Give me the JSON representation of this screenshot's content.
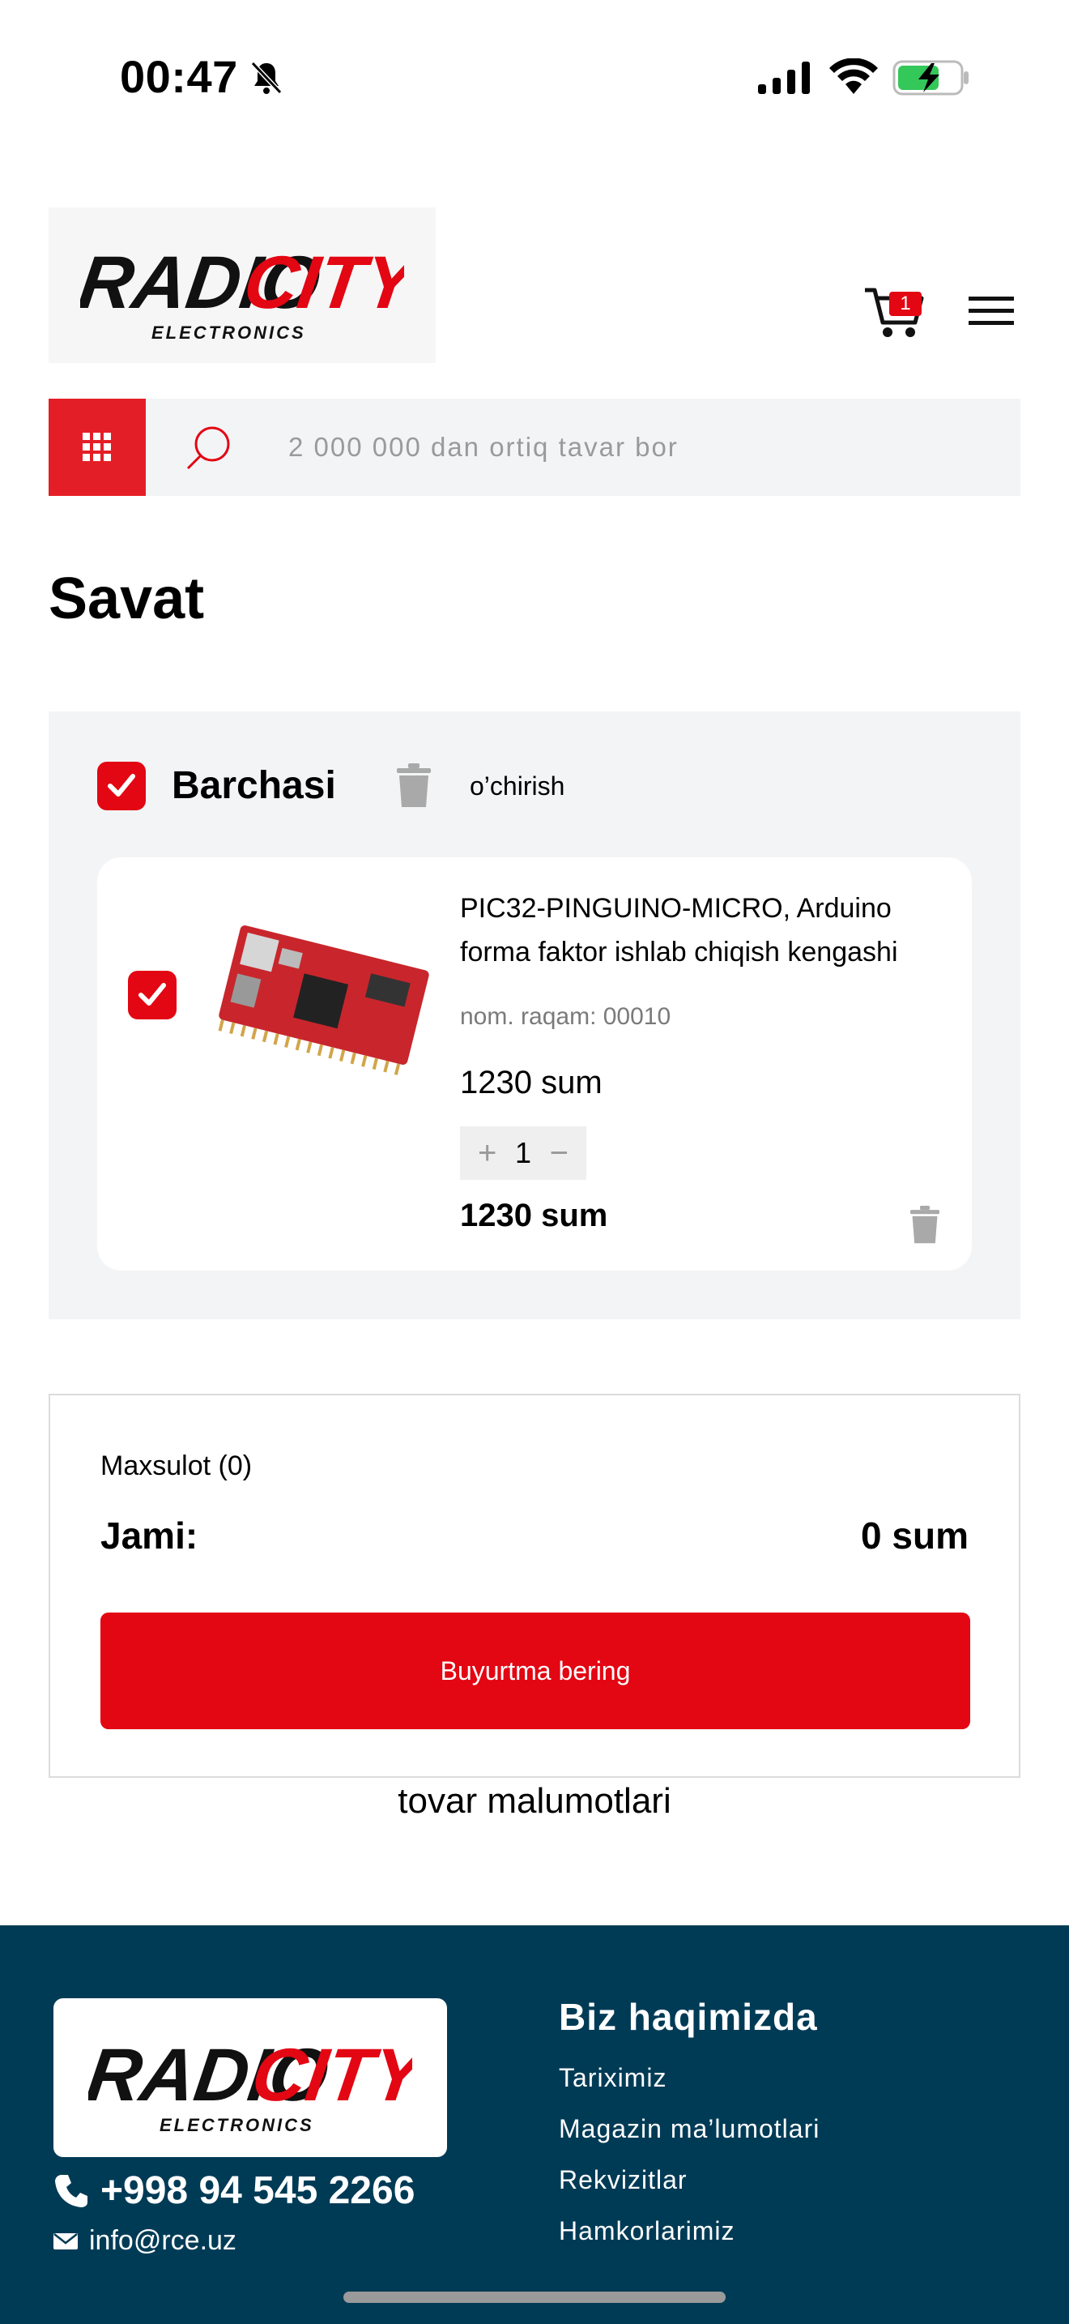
{
  "status_bar": {
    "time": "00:47"
  },
  "header": {
    "logo_text": "Radio City Electronics",
    "cart_count": "1"
  },
  "search": {
    "placeholder": "2 000 000 dan ortiq tavar bor"
  },
  "page": {
    "title": "Savat"
  },
  "cart": {
    "select_all_label": "Barchasi",
    "delete_label": "o’chirish",
    "items": [
      {
        "name": "PIC32-PINGUINO-MICRO, Arduino forma faktor ishlab chiqish kengashi",
        "sku": "nom. raqam: 00010",
        "price": "1230 sum",
        "quantity": "1",
        "total": "1230 sum"
      }
    ]
  },
  "summary": {
    "count_label": "Maxsulot (0)",
    "total_label": "Jami:",
    "total_value": "0 sum",
    "order_button": "Buyurtma bering"
  },
  "info_link": "tovar malumotlari",
  "footer": {
    "phone": "+998 94 545 2266",
    "email": "info@rce.uz",
    "about_heading": "Biz haqimizda",
    "links": [
      "Tariximiz",
      "Magazin ma’lumotlari",
      "Rekvizitlar",
      "Hamkorlarimiz"
    ]
  },
  "colors": {
    "brand_red": "#e30613",
    "footer_bg": "#003b56",
    "panel_bg": "#f3f4f6"
  }
}
